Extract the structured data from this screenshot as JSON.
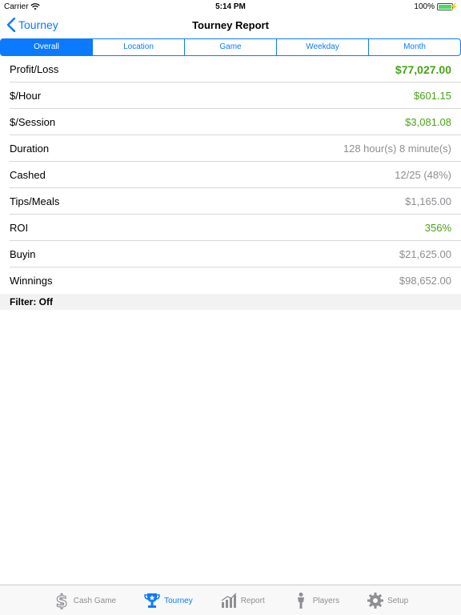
{
  "status_bar": {
    "carrier": "Carrier",
    "time": "5:14 PM",
    "battery": "100%"
  },
  "nav": {
    "back_label": "Tourney",
    "title": "Tourney Report"
  },
  "segments": [
    {
      "label": "Overall",
      "active": true
    },
    {
      "label": "Location",
      "active": false
    },
    {
      "label": "Game",
      "active": false
    },
    {
      "label": "Weekday",
      "active": false
    },
    {
      "label": "Month",
      "active": false
    }
  ],
  "rows": [
    {
      "label": "Profit/Loss",
      "value": "$77,027.00",
      "color": "green",
      "bold": true
    },
    {
      "label": "$/Hour",
      "value": "$601.15",
      "color": "green"
    },
    {
      "label": "$/Session",
      "value": "$3,081.08",
      "color": "green"
    },
    {
      "label": "Duration",
      "value": "128 hour(s) 8 minute(s)",
      "color": "gray"
    },
    {
      "label": "Cashed",
      "value": "12/25 (48%)",
      "color": "gray"
    },
    {
      "label": "Tips/Meals",
      "value": "$1,165.00",
      "color": "gray"
    },
    {
      "label": "ROI",
      "value": "356%",
      "color": "green"
    },
    {
      "label": "Buyin",
      "value": "$21,625.00",
      "color": "gray"
    },
    {
      "label": "Winnings",
      "value": "$98,652.00",
      "color": "gray"
    }
  ],
  "filter": "Filter: Off",
  "tabs": [
    {
      "label": "Cash Game",
      "icon": "dollar-icon",
      "active": false
    },
    {
      "label": "Tourney",
      "icon": "trophy-icon",
      "active": true
    },
    {
      "label": "Report",
      "icon": "chart-icon",
      "active": false
    },
    {
      "label": "Players",
      "icon": "person-icon",
      "active": false
    },
    {
      "label": "Setup",
      "icon": "gear-icon",
      "active": false
    }
  ],
  "colors": {
    "accent": "#0b7aff",
    "positive": "#48a316",
    "muted": "#8e8e93"
  }
}
